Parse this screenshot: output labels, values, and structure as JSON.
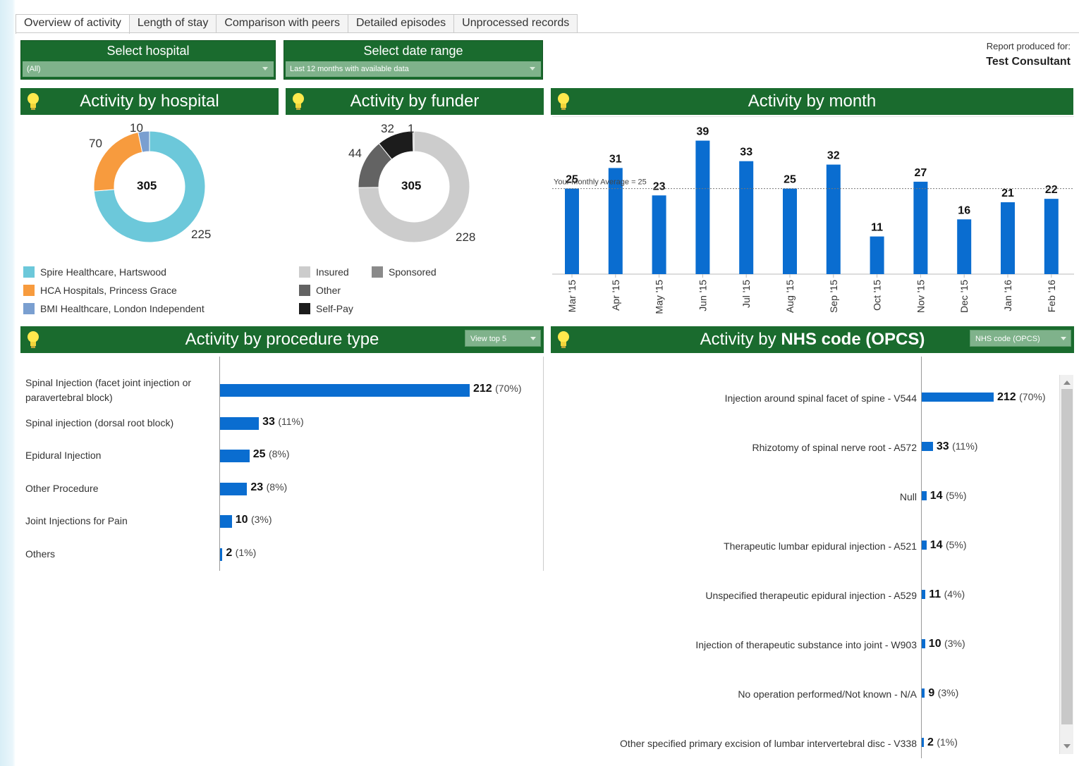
{
  "tabs": [
    {
      "label": "Overview of activity",
      "active": true
    },
    {
      "label": "Length of stay",
      "active": false
    },
    {
      "label": "Comparison with peers",
      "active": false
    },
    {
      "label": "Detailed episodes",
      "active": false
    },
    {
      "label": "Unprocessed records",
      "active": false
    }
  ],
  "filters": {
    "hospital": {
      "title": "Select hospital",
      "value": "(All)"
    },
    "date_range": {
      "title": "Select date range",
      "value": "Last 12 months with available data"
    }
  },
  "report": {
    "label": "Report produced for:",
    "name": "Test Consultant"
  },
  "panels": {
    "hospital": {
      "title": "Activity by hospital"
    },
    "funder": {
      "title": "Activity by funder"
    },
    "month": {
      "title": "Activity by month"
    },
    "procedure": {
      "title": "Activity by procedure type",
      "dropdown": "View top 5"
    },
    "nhs": {
      "title_prefix": "Activity by ",
      "title_bold": "NHS code (OPCS)",
      "dropdown": "NHS code (OPCS)"
    }
  },
  "colors": {
    "header_green": "#1a6b2e",
    "bar_blue": "#0a6dd0"
  },
  "chart_data": [
    {
      "type": "pie",
      "name": "Activity by hospital",
      "total": "305",
      "slices": [
        {
          "label": "Spire Healthcare, Hartswood",
          "value": 225,
          "color": "#6cc8da"
        },
        {
          "label": "HCA Hospitals, Princess Grace",
          "value": 70,
          "color": "#f79b3e"
        },
        {
          "label": "BMI Healthcare, London Independent",
          "value": 10,
          "color": "#7a9fd0"
        }
      ],
      "slice_labels": [
        "225",
        "70",
        "10"
      ]
    },
    {
      "type": "pie",
      "name": "Activity by funder",
      "total": "305",
      "slices": [
        {
          "label": "Insured",
          "value": 228,
          "color": "#cccccc"
        },
        {
          "label": "Other",
          "value": 44,
          "color": "#636363"
        },
        {
          "label": "Self-Pay",
          "value": 32,
          "color": "#1c1c1c"
        },
        {
          "label": "Sponsored",
          "value": 1,
          "color": "#8a8a8a"
        }
      ],
      "slice_labels": [
        "228",
        "44",
        "32",
        "1"
      ]
    },
    {
      "type": "bar",
      "name": "Activity by month",
      "categories": [
        "Mar '15",
        "Apr '15",
        "May '15",
        "Jun '15",
        "Jul '15",
        "Aug '15",
        "Sep '15",
        "Oct '15",
        "Nov '15",
        "Dec '15",
        "Jan '16",
        "Feb '16"
      ],
      "values": [
        25,
        31,
        23,
        39,
        33,
        25,
        32,
        11,
        27,
        16,
        21,
        22
      ],
      "average": 25,
      "average_label": "Your Monthly Average = 25",
      "ylim": [
        0,
        42
      ]
    },
    {
      "type": "bar",
      "name": "Activity by procedure type",
      "orientation": "horizontal",
      "categories": [
        "Spinal Injection (facet joint injection or paravertebral block)",
        "Spinal injection (dorsal root block)",
        "Epidural Injection",
        "Other Procedure",
        "Joint Injections for Pain",
        "Others"
      ],
      "values": [
        212,
        33,
        25,
        23,
        10,
        2
      ],
      "percents": [
        "(70%)",
        "(11%)",
        "(8%)",
        "(8%)",
        "(3%)",
        "(1%)"
      ]
    },
    {
      "type": "bar",
      "name": "Activity by NHS code (OPCS)",
      "orientation": "horizontal",
      "categories": [
        "Injection around spinal facet of spine - V544",
        "Rhizotomy of spinal nerve root - A572",
        "Null",
        "Therapeutic lumbar epidural injection - A521",
        "Unspecified therapeutic epidural injection - A529",
        "Injection of therapeutic substance into joint - W903",
        "No operation performed/Not known - N/A",
        "Other specified primary excision of lumbar intervertebral disc - V338"
      ],
      "values": [
        212,
        33,
        14,
        14,
        11,
        10,
        9,
        2
      ],
      "percents": [
        "(70%)",
        "(11%)",
        "(5%)",
        "(5%)",
        "(4%)",
        "(3%)",
        "(3%)",
        "(1%)"
      ]
    }
  ]
}
